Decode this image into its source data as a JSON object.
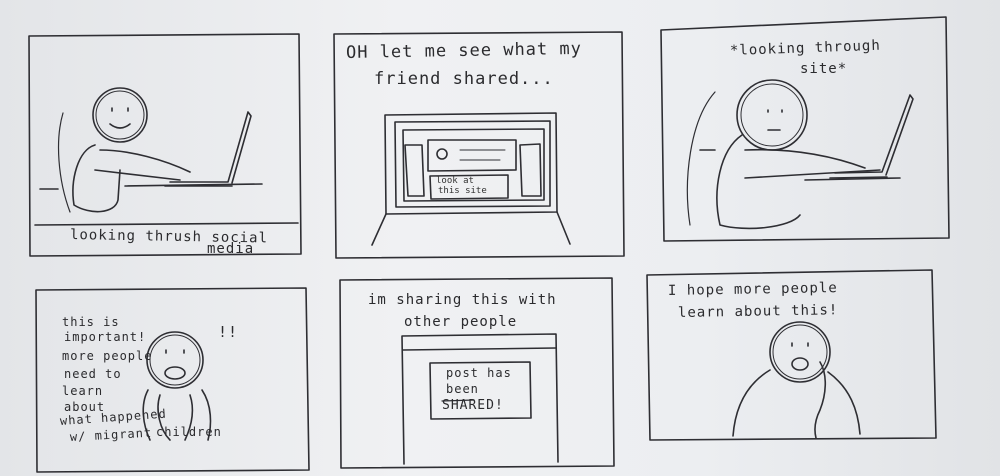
{
  "panels": [
    {
      "caption_line1": "looking thrush social",
      "caption_line2": "media"
    },
    {
      "caption_line1": "OH let me see what my",
      "caption_line2": "friend shared...",
      "screen_text_1": "look at",
      "screen_text_2": "this site"
    },
    {
      "caption_line1": "*looking through",
      "caption_line2": "site*"
    },
    {
      "text_lines": [
        "this is",
        "important!",
        "more people",
        "need to",
        "learn",
        "about",
        "what happened",
        "w/ migrant",
        "children"
      ],
      "exclaim": "!!"
    },
    {
      "caption_line1": "im sharing this with",
      "caption_line2": "other people",
      "box_line1": "post has",
      "box_line2": "been",
      "box_line3": "SHARED!"
    },
    {
      "caption_line1": "I hope more people",
      "caption_line2": "learn about this!"
    }
  ]
}
